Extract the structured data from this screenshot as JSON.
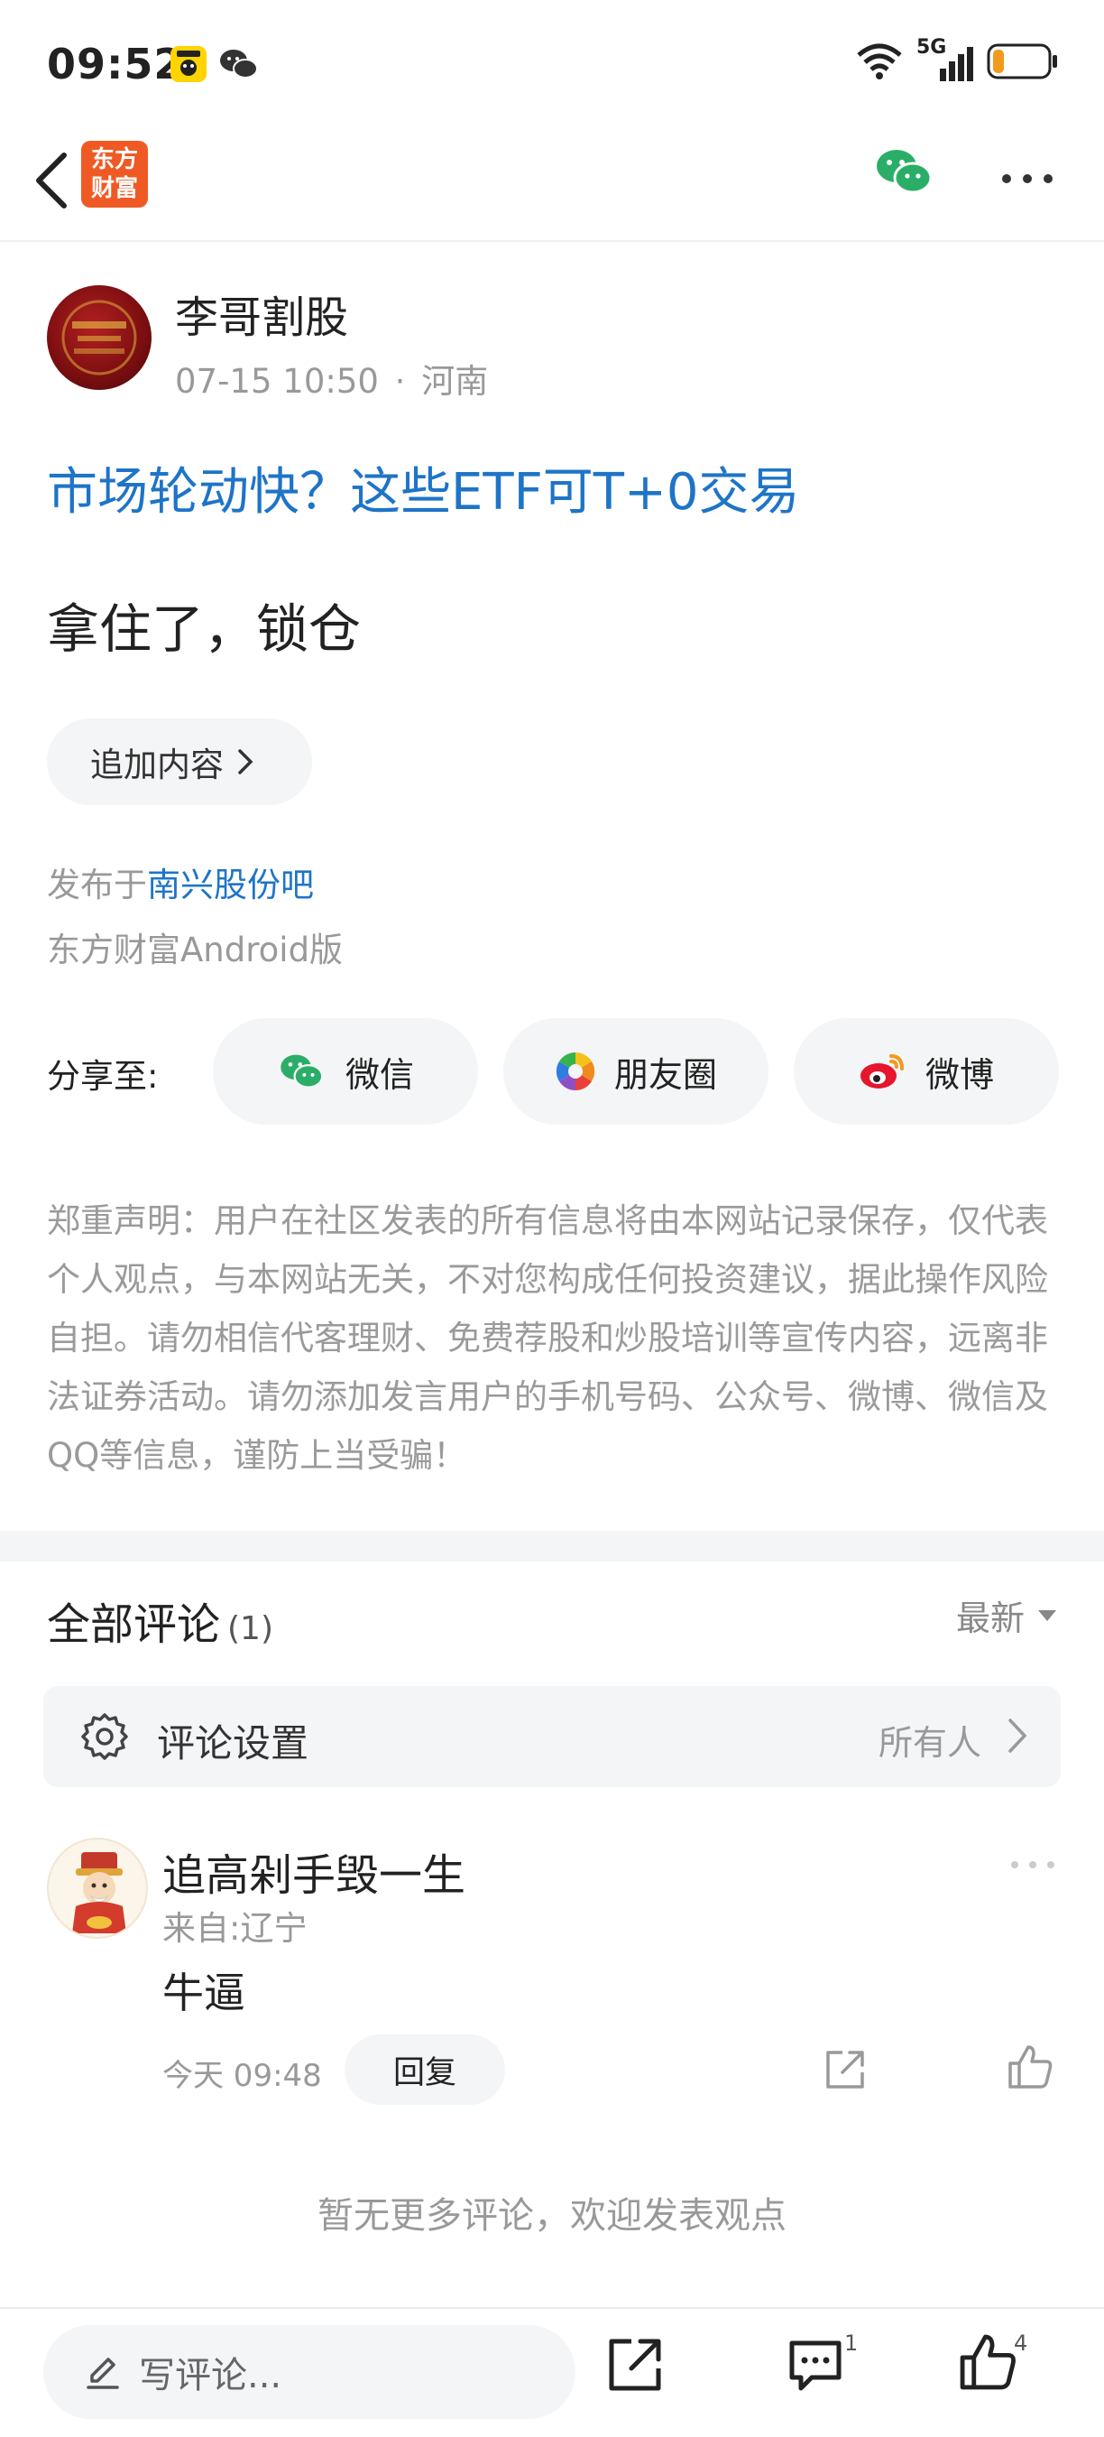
{
  "status_bar": {
    "time": "09:52",
    "network": "5G"
  },
  "nav": {
    "logo_text": "东方财富"
  },
  "post": {
    "author": "李哥割股",
    "date": "07-15 10:50",
    "sep": "·",
    "location": "河南",
    "title": "市场轮动快？这些ETF可T+0交易",
    "body": "拿住了，锁仓",
    "append_label": "追加内容",
    "published_prefix": "发布于",
    "bar_name": "南兴股份吧",
    "client": "东方财富Android版"
  },
  "share": {
    "label": "分享至:",
    "options": [
      {
        "label": "微信",
        "icon": "wechat-icon"
      },
      {
        "label": "朋友圈",
        "icon": "moments-icon"
      },
      {
        "label": "微博",
        "icon": "weibo-icon"
      }
    ]
  },
  "disclaimer": "郑重声明：用户在社区发表的所有信息将由本网站记录保存，仅代表个人观点，与本网站无关，不对您构成任何投资建议，据此操作风险自担。请勿相信代客理财、免费荐股和炒股培训等宣传内容，远离非法证券活动。请勿添加发言用户的手机号码、公众号、微博、微信及QQ等信息，谨防上当受骗！",
  "comments": {
    "title": "全部评论",
    "count": "(1)",
    "sort": "最新",
    "setting_label": "评论设置",
    "setting_value": "所有人",
    "items": [
      {
        "user": "追高剁手毁一生",
        "location": "来自:辽宁",
        "text": "牛逼",
        "time": "今天 09:48",
        "reply_label": "回复"
      }
    ],
    "no_more": "暂无更多评论，欢迎发表观点"
  },
  "bottom_bar": {
    "placeholder": "写评论...",
    "comment_count": "1",
    "like_count": "4"
  },
  "colors": {
    "accent": "#1e74c7",
    "brand": "#ef5a24",
    "wechat": "#2aae67",
    "weibo": "#e6162d"
  }
}
